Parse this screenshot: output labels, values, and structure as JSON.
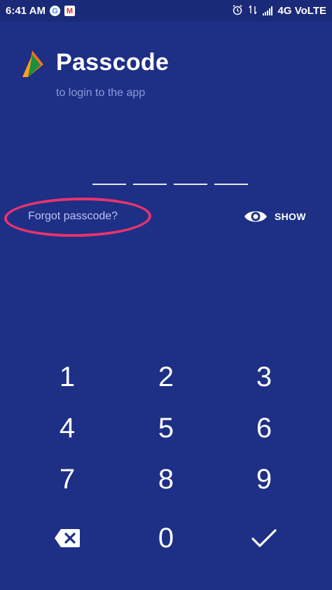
{
  "status_bar": {
    "time": "6:41 AM",
    "network": "4G VoLTE",
    "icons": [
      "google-icon",
      "gmail-icon",
      "alarm-icon",
      "data-arrows-icon",
      "signal-icon"
    ]
  },
  "header": {
    "title": "Passcode",
    "subtitle": "to login to the app",
    "logo_icon": "app-logo-icon"
  },
  "passcode": {
    "slots": 4
  },
  "actions": {
    "forgot_label": "Forgot passcode?",
    "show_label": "SHOW",
    "highlight_color": "#e8336d"
  },
  "keypad": {
    "keys": [
      "1",
      "2",
      "3",
      "4",
      "5",
      "6",
      "7",
      "8",
      "9",
      "0"
    ],
    "backspace_icon": "backspace-icon",
    "submit_icon": "checkmark-icon"
  },
  "colors": {
    "background": "#1e2f86",
    "accent": "#e8336d",
    "subtitle": "#8a9ad8"
  }
}
